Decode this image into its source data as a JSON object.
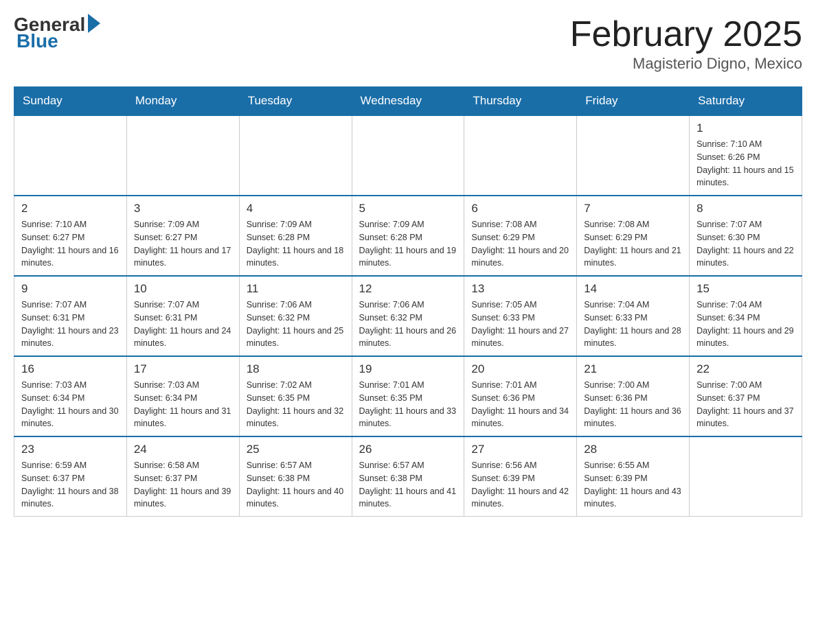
{
  "header": {
    "logo": {
      "general": "General",
      "blue": "Blue"
    },
    "title": "February 2025",
    "location": "Magisterio Digno, Mexico"
  },
  "days_of_week": [
    "Sunday",
    "Monday",
    "Tuesday",
    "Wednesday",
    "Thursday",
    "Friday",
    "Saturday"
  ],
  "weeks": [
    [
      {
        "day": "",
        "info": ""
      },
      {
        "day": "",
        "info": ""
      },
      {
        "day": "",
        "info": ""
      },
      {
        "day": "",
        "info": ""
      },
      {
        "day": "",
        "info": ""
      },
      {
        "day": "",
        "info": ""
      },
      {
        "day": "1",
        "info": "Sunrise: 7:10 AM\nSunset: 6:26 PM\nDaylight: 11 hours and 15 minutes."
      }
    ],
    [
      {
        "day": "2",
        "info": "Sunrise: 7:10 AM\nSunset: 6:27 PM\nDaylight: 11 hours and 16 minutes."
      },
      {
        "day": "3",
        "info": "Sunrise: 7:09 AM\nSunset: 6:27 PM\nDaylight: 11 hours and 17 minutes."
      },
      {
        "day": "4",
        "info": "Sunrise: 7:09 AM\nSunset: 6:28 PM\nDaylight: 11 hours and 18 minutes."
      },
      {
        "day": "5",
        "info": "Sunrise: 7:09 AM\nSunset: 6:28 PM\nDaylight: 11 hours and 19 minutes."
      },
      {
        "day": "6",
        "info": "Sunrise: 7:08 AM\nSunset: 6:29 PM\nDaylight: 11 hours and 20 minutes."
      },
      {
        "day": "7",
        "info": "Sunrise: 7:08 AM\nSunset: 6:29 PM\nDaylight: 11 hours and 21 minutes."
      },
      {
        "day": "8",
        "info": "Sunrise: 7:07 AM\nSunset: 6:30 PM\nDaylight: 11 hours and 22 minutes."
      }
    ],
    [
      {
        "day": "9",
        "info": "Sunrise: 7:07 AM\nSunset: 6:31 PM\nDaylight: 11 hours and 23 minutes."
      },
      {
        "day": "10",
        "info": "Sunrise: 7:07 AM\nSunset: 6:31 PM\nDaylight: 11 hours and 24 minutes."
      },
      {
        "day": "11",
        "info": "Sunrise: 7:06 AM\nSunset: 6:32 PM\nDaylight: 11 hours and 25 minutes."
      },
      {
        "day": "12",
        "info": "Sunrise: 7:06 AM\nSunset: 6:32 PM\nDaylight: 11 hours and 26 minutes."
      },
      {
        "day": "13",
        "info": "Sunrise: 7:05 AM\nSunset: 6:33 PM\nDaylight: 11 hours and 27 minutes."
      },
      {
        "day": "14",
        "info": "Sunrise: 7:04 AM\nSunset: 6:33 PM\nDaylight: 11 hours and 28 minutes."
      },
      {
        "day": "15",
        "info": "Sunrise: 7:04 AM\nSunset: 6:34 PM\nDaylight: 11 hours and 29 minutes."
      }
    ],
    [
      {
        "day": "16",
        "info": "Sunrise: 7:03 AM\nSunset: 6:34 PM\nDaylight: 11 hours and 30 minutes."
      },
      {
        "day": "17",
        "info": "Sunrise: 7:03 AM\nSunset: 6:34 PM\nDaylight: 11 hours and 31 minutes."
      },
      {
        "day": "18",
        "info": "Sunrise: 7:02 AM\nSunset: 6:35 PM\nDaylight: 11 hours and 32 minutes."
      },
      {
        "day": "19",
        "info": "Sunrise: 7:01 AM\nSunset: 6:35 PM\nDaylight: 11 hours and 33 minutes."
      },
      {
        "day": "20",
        "info": "Sunrise: 7:01 AM\nSunset: 6:36 PM\nDaylight: 11 hours and 34 minutes."
      },
      {
        "day": "21",
        "info": "Sunrise: 7:00 AM\nSunset: 6:36 PM\nDaylight: 11 hours and 36 minutes."
      },
      {
        "day": "22",
        "info": "Sunrise: 7:00 AM\nSunset: 6:37 PM\nDaylight: 11 hours and 37 minutes."
      }
    ],
    [
      {
        "day": "23",
        "info": "Sunrise: 6:59 AM\nSunset: 6:37 PM\nDaylight: 11 hours and 38 minutes."
      },
      {
        "day": "24",
        "info": "Sunrise: 6:58 AM\nSunset: 6:37 PM\nDaylight: 11 hours and 39 minutes."
      },
      {
        "day": "25",
        "info": "Sunrise: 6:57 AM\nSunset: 6:38 PM\nDaylight: 11 hours and 40 minutes."
      },
      {
        "day": "26",
        "info": "Sunrise: 6:57 AM\nSunset: 6:38 PM\nDaylight: 11 hours and 41 minutes."
      },
      {
        "day": "27",
        "info": "Sunrise: 6:56 AM\nSunset: 6:39 PM\nDaylight: 11 hours and 42 minutes."
      },
      {
        "day": "28",
        "info": "Sunrise: 6:55 AM\nSunset: 6:39 PM\nDaylight: 11 hours and 43 minutes."
      },
      {
        "day": "",
        "info": ""
      }
    ]
  ]
}
